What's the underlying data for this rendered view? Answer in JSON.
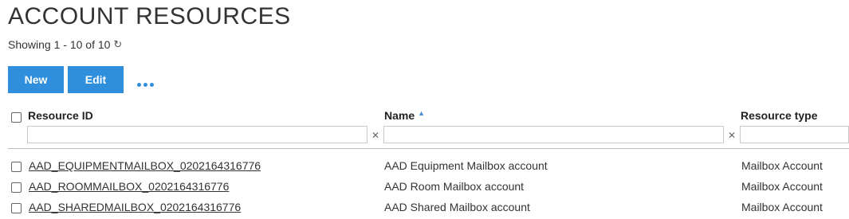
{
  "page": {
    "title": "ACCOUNT RESOURCES",
    "showing": "Showing 1 - 10 of 10",
    "refresh_icon": "refresh-icon"
  },
  "toolbar": {
    "new_label": "New",
    "edit_label": "Edit",
    "more_icon": "more-horizontal-icon",
    "accent_color": "#2f8fdd"
  },
  "table": {
    "columns": [
      {
        "label": "Resource ID"
      },
      {
        "label": "Name",
        "sort": "ascending"
      },
      {
        "label": "Resource type"
      }
    ],
    "filters": [
      {
        "value": "",
        "placeholder": ""
      },
      {
        "value": "",
        "placeholder": ""
      },
      {
        "value": "",
        "placeholder": ""
      }
    ],
    "rows": [
      {
        "resource_id": "AAD_EQUIPMENTMAILBOX_0202164316776",
        "name": "AAD Equipment Mailbox account",
        "type": "Mailbox Account"
      },
      {
        "resource_id": "AAD_ROOMMAILBOX_0202164316776",
        "name": "AAD Room Mailbox account",
        "type": "Mailbox Account"
      },
      {
        "resource_id": "AAD_SHAREDMAILBOX_0202164316776",
        "name": "AAD Shared Mailbox account",
        "type": "Mailbox Account"
      }
    ]
  }
}
